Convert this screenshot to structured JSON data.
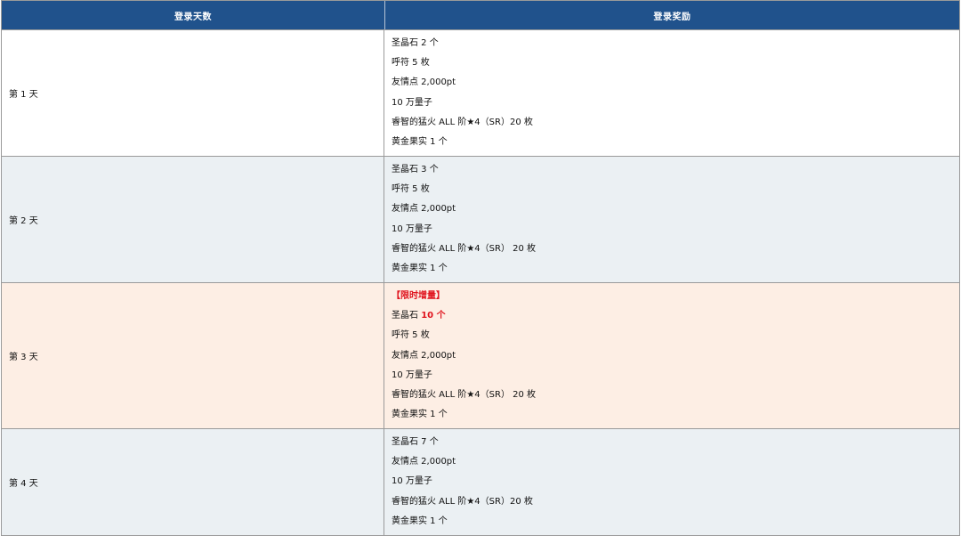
{
  "header": {
    "col_day": "登录天数",
    "col_reward": "登录奖励"
  },
  "rows": [
    {
      "day": "第 1 天",
      "rewards": [
        "圣晶石 2 个",
        "呼符 5 枚",
        "友情点 2,000pt",
        "10 万量子",
        "睿智的猛火 ALL 阶★4（SR）20 枚",
        "黄金果实 1 个"
      ]
    },
    {
      "day": "第 2 天",
      "rewards": [
        "圣晶石 3 个",
        "呼符 5 枚",
        "友情点 2,000pt",
        "10 万量子",
        "睿智的猛火 ALL 阶★4（SR） 20 枚",
        "黄金果实 1 个"
      ]
    },
    {
      "day": "第 3 天",
      "tag": "【限时增量】",
      "highlight_prefix": "圣晶石 ",
      "highlight_value": "10 个",
      "rewards": [
        "呼符 5 枚",
        "友情点 2,000pt",
        "10 万量子",
        "睿智的猛火 ALL 阶★4（SR） 20 枚",
        "黄金果实 1 个"
      ]
    },
    {
      "day": "第 4 天",
      "rewards": [
        "圣晶石 7 个",
        "友情点 2,000pt",
        "10 万量子",
        "睿智的猛火 ALL 阶★4（SR）20 枚",
        "黄金果实 1 个"
      ]
    }
  ],
  "colors": {
    "header_bg": "#20528c",
    "highlight": "#e0141e",
    "row_grey": "#ebf0f3",
    "row_peach": "#fdeee4"
  }
}
